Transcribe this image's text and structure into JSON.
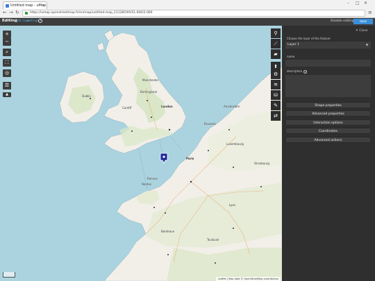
{
  "browser": {
    "tab_title": "Untitled map - uMap",
    "url": "https://umap.openstreetmap.fr/en/map/untitled-map_111285#6/51.000/2.000",
    "back_icon": "back-arrow-icon",
    "forward_icon": "forward-arrow-icon",
    "reload_icon": "reload-icon",
    "menu_icon": "hamburger-menu-icon"
  },
  "toolbar": {
    "mode": "Editing",
    "link_1": "Edit map",
    "link_2": "settings",
    "disable_label": "Disable editing",
    "save_label": "Save"
  },
  "map": {
    "zoom_in": "+",
    "zoom_out": "−",
    "place_labels": [
      {
        "text": "Dublin"
      },
      {
        "text": "Manchester"
      },
      {
        "text": "Birmingham"
      },
      {
        "text": "London"
      },
      {
        "text": "Cardiff"
      },
      {
        "text": "Amsterdam"
      },
      {
        "text": "Brussels"
      },
      {
        "text": "Paris"
      },
      {
        "text": "Nantes"
      },
      {
        "text": "Bordeaux"
      },
      {
        "text": "Toulouse"
      },
      {
        "text": "Lyon"
      },
      {
        "text": "Luxembourg"
      },
      {
        "text": "Strasbourg"
      },
      {
        "text": "Rennes"
      }
    ],
    "attribution": "Leaflet | Map data © OpenStreetMap contributors"
  },
  "panel": {
    "close_label": "Close",
    "layer_question": "Choose the layer of the feature",
    "layer_value": "Layer 1",
    "name_label": "name",
    "description_label": "description",
    "buttons": [
      "Shape properties",
      "Advanced properties",
      "Interaction options",
      "Coordinates",
      "Advanced actions"
    ]
  },
  "colors": {
    "sea": "#aad3df",
    "land": "#f2efe9",
    "panel_bg": "#2f2f2f",
    "marker": "#1e2a9a",
    "save_button": "#3a8fd9"
  }
}
